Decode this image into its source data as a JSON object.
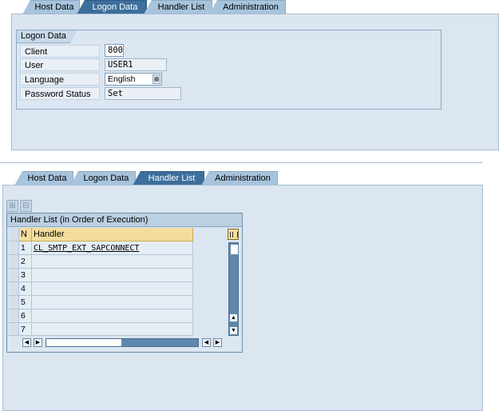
{
  "top": {
    "tabs": [
      {
        "label": "Host Data",
        "active": false
      },
      {
        "label": "Logon Data",
        "active": true
      },
      {
        "label": "Handler List",
        "active": false
      },
      {
        "label": "Administration",
        "active": false
      }
    ],
    "group_title": "Logon Data",
    "fields": [
      {
        "label": "Client",
        "value": "800"
      },
      {
        "label": "User",
        "value": "USER1"
      },
      {
        "label": "Language",
        "value": "English"
      },
      {
        "label": "Password Status",
        "value": "Set"
      }
    ]
  },
  "bottom": {
    "tabs": [
      {
        "label": "Host Data",
        "active": false
      },
      {
        "label": "Logon Data",
        "active": false
      },
      {
        "label": "Handler List",
        "active": true
      },
      {
        "label": "Administration",
        "active": false
      }
    ],
    "table": {
      "title": "Handler List (in Order of Execution)",
      "columns": [
        "N",
        "Handler"
      ],
      "rows": [
        {
          "n": "1",
          "handler": "CL_SMTP_EXT_SAPCONNECT"
        },
        {
          "n": "2",
          "handler": ""
        },
        {
          "n": "3",
          "handler": ""
        },
        {
          "n": "4",
          "handler": ""
        },
        {
          "n": "5",
          "handler": ""
        },
        {
          "n": "6",
          "handler": ""
        },
        {
          "n": "7",
          "handler": ""
        }
      ]
    }
  },
  "icons": {
    "dropdown": "dropdown-icon",
    "insert_row": "insert-row-icon",
    "delete_row": "delete-row-icon",
    "column_config": "table-settings-icon"
  }
}
